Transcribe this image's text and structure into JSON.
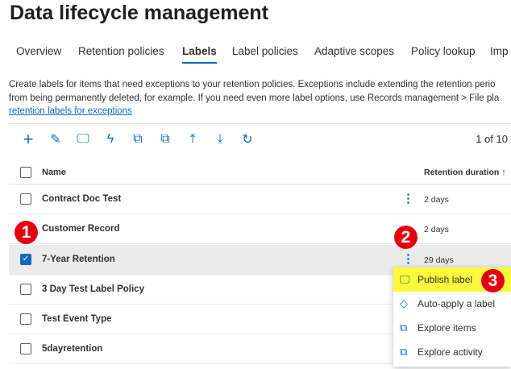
{
  "title": "Data lifecycle management",
  "tabs": [
    "Overview",
    "Retention policies",
    "Labels",
    "Label policies",
    "Adaptive scopes",
    "Policy lookup",
    "Imp"
  ],
  "description": {
    "line1": "Create labels for items that need exceptions to your retention policies. Exceptions include extending the retention perio",
    "line2": "from being permanently deleted, for example. If you need even more label options, use Records management > File pla",
    "link": "retention labels for exceptions"
  },
  "toolbar": {
    "icons": [
      "add-icon",
      "edit-icon",
      "publish-icon",
      "auto-apply-icon",
      "explore-items-icon",
      "explore-activity-icon",
      "import-icon",
      "export-icon",
      "refresh-icon"
    ],
    "pager": "1 of 10"
  },
  "table": {
    "col_name": "Name",
    "col_duration": "Retention duration ↑",
    "rows": [
      {
        "name": "Contract Doc Test",
        "duration": "2 days",
        "selected": false
      },
      {
        "name": "Customer Record",
        "duration": "2 days",
        "selected": false
      },
      {
        "name": "7-Year Retention",
        "duration": "29 days",
        "selected": true
      },
      {
        "name": "3 Day Test Label Policy",
        "duration": "",
        "selected": false
      },
      {
        "name": "Test Event Type",
        "duration": "",
        "selected": false
      },
      {
        "name": "5dayretention",
        "duration": "",
        "selected": false
      }
    ]
  },
  "menu": [
    "Publish label",
    "Auto-apply a label",
    "Explore items",
    "Explore activity"
  ],
  "badges": [
    "1",
    "2",
    "3"
  ],
  "colors": {
    "accent": "#0f6cbd",
    "badge": "#e3000f",
    "highlight": "#fafa3c"
  }
}
